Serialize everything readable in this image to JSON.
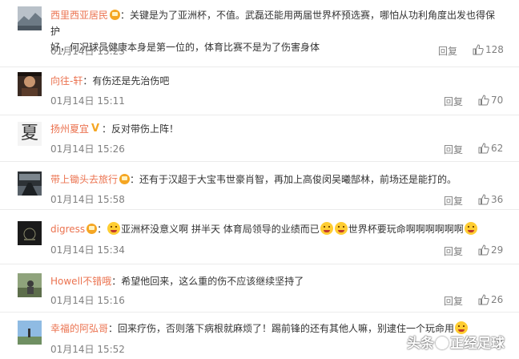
{
  "comments": [
    {
      "user": "西里西亚居民",
      "badge": "crown-badge",
      "text_lines": [
        "：关键是为了亚洲杯，不值。武磊还能用两届世界杯预选赛，哪怕从功利角度出发也得保护",
        "好，何况球员健康本身是第一位的，体育比赛不是为了伤害身体"
      ],
      "time": "01月14日 15:23",
      "reply": "回复",
      "likes": "128"
    },
    {
      "user": "向往-轩",
      "text": "：有伤还是先治伤吧",
      "time": "01月14日 15:11",
      "reply": "回复",
      "likes": "70"
    },
    {
      "user": "扬州夏宜",
      "badge": "v-badge",
      "avatar_char": "夏",
      "text": "：反对带伤上阵！",
      "time": "01月14日 15:26",
      "reply": "回复",
      "likes": "62"
    },
    {
      "user": "带上锄头去旅行",
      "badge": "crown-badge",
      "text": "：还有于汉超于大宝韦世豪肖智，再加上高俊闵吴曦郜林，前场还是能打的。",
      "time": "01月14日 15:58",
      "reply": "回复",
      "likes": "36"
    },
    {
      "user": "digress",
      "badge": "crown-badge",
      "text_parts": [
        "：",
        "亚洲杯没意义啊 拼半天 体育局领导的业绩而已",
        "世界杯要玩命啊啊啊啊啊啊"
      ],
      "time": "01月14日 15:34",
      "reply": "回复",
      "likes": "29"
    },
    {
      "user": "Howell不错哦",
      "text": "：希望他回来，这么重的伤不应该继续坚持了",
      "time": "01月14日 15:16",
      "reply": "回复",
      "likes": "26"
    },
    {
      "user": "幸福的阿弘哥",
      "text": "：回来疗伤，否则落下病根就麻烦了！踢前锋的还有其他人嘛，别逮住一个玩命用",
      "time": "01月14日 15:52",
      "reply": "回复",
      "likes": ""
    }
  ],
  "watermark": {
    "prefix": "头条",
    "suffix": "正经足球"
  },
  "colors": {
    "username": "#eb7350",
    "meta": "#808080",
    "divider": "#ebebeb"
  }
}
